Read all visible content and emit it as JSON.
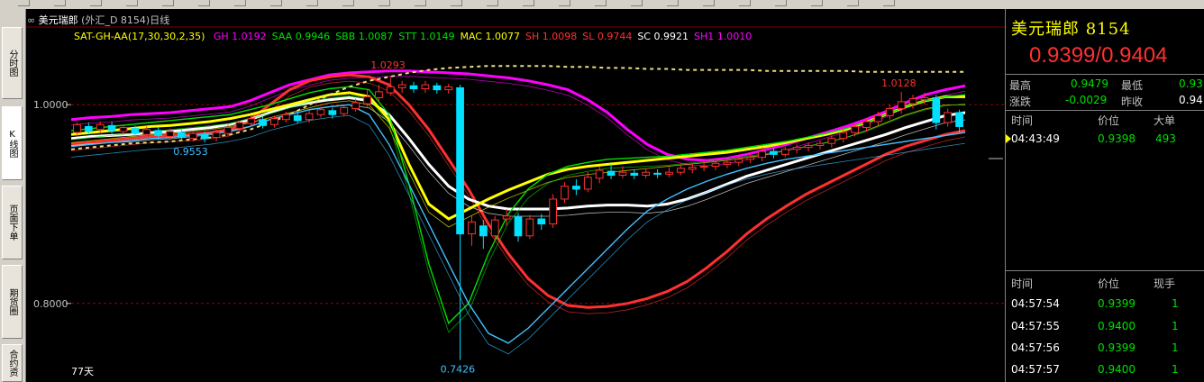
{
  "window": {
    "title_symbol": "美元瑞郎",
    "title_detail": "(外汇_D 8154)日线",
    "link_icon": "link-icon"
  },
  "sidebar": {
    "tabs": [
      {
        "label": "分时图",
        "active": false
      },
      {
        "label": "K线图",
        "active": true
      },
      {
        "label": "页面下单",
        "active": false
      },
      {
        "label": "期货圈",
        "active": false
      },
      {
        "label": "合约资",
        "active": false
      }
    ]
  },
  "indicator": {
    "name": "SAT-GH-AA(17,30,30,2,35)",
    "items": [
      {
        "label": "GH",
        "value": "1.0192",
        "color": "#ff00ff"
      },
      {
        "label": "SAA",
        "value": "0.9946",
        "color": "#00e000"
      },
      {
        "label": "SBB",
        "value": "1.0087",
        "color": "#00e000"
      },
      {
        "label": "STT",
        "value": "1.0149",
        "color": "#00e000"
      },
      {
        "label": "MAC",
        "value": "1.0077",
        "color": "#ffff00"
      },
      {
        "label": "SH",
        "value": "1.0098",
        "color": "#ff3030"
      },
      {
        "label": "SL",
        "value": "0.9744",
        "color": "#ff3030"
      },
      {
        "label": "SC",
        "value": "0.9921",
        "color": "#ffffff"
      },
      {
        "label": "SH1",
        "value": "1.0010",
        "color": "#ff00ff"
      }
    ]
  },
  "chart_data": {
    "type": "candlestick",
    "yaxis_ticks": [
      "1.0000",
      "0.8000"
    ],
    "ylim": [
      0.73,
      1.06
    ],
    "annotations": [
      {
        "text": "1.0293",
        "kind": "high",
        "color": "#ff3030"
      },
      {
        "text": "0.9553",
        "kind": "low",
        "color": "#40c0ff"
      },
      {
        "text": "0.7426",
        "kind": "low",
        "color": "#40c0ff"
      },
      {
        "text": "1.0128",
        "kind": "high",
        "color": "#ff3030"
      }
    ],
    "period_label": "77天",
    "candles": [
      [
        0.972,
        0.98,
        0.968,
        0.982
      ],
      [
        0.978,
        0.973,
        0.97,
        0.982
      ],
      [
        0.975,
        0.98,
        0.972,
        0.983
      ],
      [
        0.979,
        0.974,
        0.971,
        0.983
      ],
      [
        0.973,
        0.977,
        0.97,
        0.98
      ],
      [
        0.976,
        0.971,
        0.968,
        0.979
      ],
      [
        0.97,
        0.975,
        0.967,
        0.978
      ],
      [
        0.974,
        0.969,
        0.966,
        0.977
      ],
      [
        0.968,
        0.973,
        0.964,
        0.976
      ],
      [
        0.972,
        0.967,
        0.964,
        0.975
      ],
      [
        0.966,
        0.971,
        0.963,
        0.974
      ],
      [
        0.97,
        0.966,
        0.962,
        0.973
      ],
      [
        0.967,
        0.972,
        0.963,
        0.975
      ],
      [
        0.971,
        0.977,
        0.968,
        0.98
      ],
      [
        0.976,
        0.982,
        0.973,
        0.984
      ],
      [
        0.981,
        0.986,
        0.978,
        0.989
      ],
      [
        0.985,
        0.979,
        0.976,
        0.988
      ],
      [
        0.98,
        0.986,
        0.977,
        0.989
      ],
      [
        0.985,
        0.99,
        0.982,
        0.993
      ],
      [
        0.989,
        0.984,
        0.981,
        0.992
      ],
      [
        0.985,
        0.991,
        0.982,
        0.994
      ],
      [
        0.99,
        0.995,
        0.987,
        0.998
      ],
      [
        0.994,
        0.99,
        0.986,
        0.997
      ],
      [
        0.991,
        0.997,
        0.988,
        1.0
      ],
      [
        0.996,
        1.002,
        0.993,
        1.006
      ],
      [
        1.001,
        1.008,
        0.998,
        1.015
      ],
      [
        1.007,
        1.013,
        1.004,
        1.02
      ],
      [
        1.012,
        1.018,
        1.009,
        1.029
      ],
      [
        1.017,
        1.02,
        1.012,
        1.024
      ],
      [
        1.019,
        1.016,
        1.012,
        1.023
      ],
      [
        1.016,
        1.02,
        1.012,
        1.024
      ],
      [
        1.019,
        1.015,
        1.011,
        1.022
      ],
      [
        1.015,
        1.018,
        1.011,
        1.021
      ],
      [
        1.017,
        0.87,
        0.743,
        1.02
      ],
      [
        0.87,
        0.882,
        0.858,
        0.888
      ],
      [
        0.878,
        0.868,
        0.855,
        0.884
      ],
      [
        0.868,
        0.884,
        0.863,
        0.888
      ],
      [
        0.885,
        0.888,
        0.878,
        0.895
      ],
      [
        0.887,
        0.868,
        0.862,
        0.891
      ],
      [
        0.868,
        0.885,
        0.865,
        0.889
      ],
      [
        0.885,
        0.88,
        0.874,
        0.89
      ],
      [
        0.88,
        0.905,
        0.876,
        0.91
      ],
      [
        0.905,
        0.918,
        0.901,
        0.922
      ],
      [
        0.918,
        0.915,
        0.909,
        0.925
      ],
      [
        0.915,
        0.927,
        0.912,
        0.932
      ],
      [
        0.926,
        0.934,
        0.921,
        0.938
      ],
      [
        0.933,
        0.929,
        0.925,
        0.94
      ],
      [
        0.929,
        0.932,
        0.926,
        0.938
      ],
      [
        0.931,
        0.929,
        0.925,
        0.935
      ],
      [
        0.929,
        0.932,
        0.926,
        0.936
      ],
      [
        0.931,
        0.93,
        0.926,
        0.935
      ],
      [
        0.93,
        0.932,
        0.927,
        0.937
      ],
      [
        0.932,
        0.936,
        0.929,
        0.94
      ],
      [
        0.935,
        0.937,
        0.931,
        0.941
      ],
      [
        0.937,
        0.938,
        0.933,
        0.942
      ],
      [
        0.938,
        0.941,
        0.934,
        0.944
      ],
      [
        0.94,
        0.942,
        0.936,
        0.946
      ],
      [
        0.942,
        0.945,
        0.938,
        0.948
      ],
      [
        0.945,
        0.947,
        0.941,
        0.951
      ],
      [
        0.947,
        0.953,
        0.943,
        0.957
      ],
      [
        0.953,
        0.95,
        0.946,
        0.956
      ],
      [
        0.95,
        0.955,
        0.947,
        0.958
      ],
      [
        0.955,
        0.957,
        0.951,
        0.96
      ],
      [
        0.957,
        0.959,
        0.953,
        0.962
      ],
      [
        0.959,
        0.961,
        0.955,
        0.964
      ],
      [
        0.961,
        0.966,
        0.957,
        0.969
      ],
      [
        0.966,
        0.972,
        0.962,
        0.975
      ],
      [
        0.972,
        0.978,
        0.968,
        0.981
      ],
      [
        0.977,
        0.983,
        0.973,
        0.986
      ],
      [
        0.983,
        0.989,
        0.979,
        0.993
      ],
      [
        0.989,
        0.996,
        0.985,
        1.0
      ],
      [
        0.996,
        1.003,
        0.991,
        1.013
      ],
      [
        1.001,
        1.006,
        0.996,
        1.01
      ],
      [
        1.005,
        1.007,
        1.0,
        1.012
      ],
      [
        1.007,
        0.982,
        0.975,
        1.01
      ],
      [
        0.982,
        0.992,
        0.978,
        0.996
      ],
      [
        0.992,
        0.978,
        0.972,
        0.995
      ]
    ],
    "series": [
      {
        "color": "#ff00ff",
        "values": [
          0.985,
          0.987,
          0.988,
          0.99,
          0.991,
          0.992,
          0.994,
          0.996,
          0.998,
          1.004,
          1.012,
          1.02,
          1.025,
          1.03,
          1.032,
          1.033,
          1.034,
          1.034,
          1.033,
          1.032,
          1.031,
          1.029,
          1.027,
          1.024,
          1.02,
          1.015,
          1.005,
          0.992,
          0.975,
          0.96,
          0.95,
          0.945,
          0.944,
          0.946,
          0.95,
          0.955,
          0.96,
          0.966,
          0.972,
          0.978,
          0.985,
          0.993,
          1.002,
          1.01,
          1.015,
          1.019
        ]
      },
      {
        "color": "#ff3030",
        "values": [
          0.96,
          0.962,
          0.964,
          0.966,
          0.968,
          0.969,
          0.97,
          0.972,
          0.975,
          0.985,
          1.0,
          1.015,
          1.024,
          1.028,
          1.03,
          1.028,
          1.02,
          1.0,
          0.975,
          0.945,
          0.915,
          0.88,
          0.85,
          0.825,
          0.808,
          0.798,
          0.796,
          0.797,
          0.8,
          0.805,
          0.812,
          0.822,
          0.836,
          0.852,
          0.87,
          0.885,
          0.898,
          0.91,
          0.92,
          0.93,
          0.94,
          0.95,
          0.958,
          0.964,
          0.97,
          0.974
        ]
      },
      {
        "color": "#ffffff",
        "values": [
          0.966,
          0.968,
          0.969,
          0.97,
          0.972,
          0.973,
          0.975,
          0.977,
          0.98,
          0.985,
          0.992,
          0.998,
          1.002,
          1.005,
          1.007,
          1.004,
          0.99,
          0.966,
          0.94,
          0.918,
          0.905,
          0.898,
          0.895,
          0.895,
          0.895,
          0.896,
          0.898,
          0.899,
          0.899,
          0.898,
          0.9,
          0.905,
          0.912,
          0.92,
          0.928,
          0.934,
          0.94,
          0.946,
          0.952,
          0.958,
          0.964,
          0.97,
          0.977,
          0.983,
          0.989,
          0.992
        ]
      },
      {
        "color": "#ffff00",
        "values": [
          0.97,
          0.972,
          0.974,
          0.976,
          0.978,
          0.979,
          0.981,
          0.983,
          0.986,
          0.99,
          0.995,
          1.0,
          1.005,
          1.01,
          1.012,
          1.008,
          0.985,
          0.94,
          0.9,
          0.885,
          0.895,
          0.905,
          0.914,
          0.922,
          0.93,
          0.935,
          0.938,
          0.94,
          0.942,
          0.944,
          0.946,
          0.948,
          0.95,
          0.952,
          0.955,
          0.958,
          0.962,
          0.966,
          0.97,
          0.975,
          0.982,
          0.99,
          0.998,
          1.004,
          1.008,
          1.008
        ]
      },
      {
        "color": "#00e000",
        "values": [
          0.974,
          0.976,
          0.978,
          0.98,
          0.982,
          0.984,
          0.986,
          0.988,
          0.99,
          0.995,
          1.0,
          1.006,
          1.012,
          1.016,
          1.018,
          1.015,
          0.99,
          0.92,
          0.84,
          0.78,
          0.8,
          0.85,
          0.89,
          0.915,
          0.93,
          0.938,
          0.942,
          0.945,
          0.946,
          0.947,
          0.948,
          0.95,
          0.952,
          0.954,
          0.957,
          0.96,
          0.963,
          0.967,
          0.971,
          0.976,
          0.982,
          0.99,
          0.998,
          1.004,
          1.008,
          1.01
        ]
      },
      {
        "color": "#e0e0e0",
        "dashed": true,
        "values": [
          0.955,
          0.957,
          0.959,
          0.961,
          0.962,
          0.963,
          0.965,
          0.967,
          0.97,
          0.975,
          0.982,
          0.99,
          1.0,
          1.01,
          1.018,
          1.024,
          1.028,
          1.032,
          1.035,
          1.037,
          1.038,
          1.039,
          1.039,
          1.039,
          1.039,
          1.038,
          1.038,
          1.037,
          1.037,
          1.036,
          1.036,
          1.035,
          1.035,
          1.035,
          1.035,
          1.034,
          1.034,
          1.034,
          1.034,
          1.034,
          1.033,
          1.033,
          1.033,
          1.033,
          1.033,
          1.033
        ]
      },
      {
        "color": "#40c0ff",
        "values": [
          0.958,
          0.96,
          0.962,
          0.964,
          0.966,
          0.967,
          0.969,
          0.971,
          0.974,
          0.978,
          0.985,
          0.99,
          0.995,
          0.998,
          1.0,
          0.99,
          0.96,
          0.92,
          0.88,
          0.84,
          0.8,
          0.77,
          0.76,
          0.775,
          0.795,
          0.815,
          0.835,
          0.855,
          0.875,
          0.893,
          0.905,
          0.915,
          0.923,
          0.93,
          0.936,
          0.941,
          0.945,
          0.948,
          0.951,
          0.954,
          0.957,
          0.96,
          0.963,
          0.966,
          0.969,
          0.972
        ]
      }
    ]
  },
  "right_panel": {
    "title": "美元瑞郎  8154",
    "quote": "0.9399/0.9404",
    "stats": [
      {
        "label": "最高",
        "value": "0.9479",
        "label2": "最低",
        "value2": "0.93"
      },
      {
        "label": "涨跌",
        "value": "-0.0029",
        "label2": "昨收",
        "value2": "0.94"
      }
    ],
    "big_orders_header": {
      "time": "时间",
      "price": "价位",
      "vol": "大单"
    },
    "big_orders": [
      {
        "time": "04:43:49",
        "price": "0.9398",
        "vol": "493"
      }
    ],
    "ticks_header": {
      "time": "时间",
      "price": "价位",
      "vol": "现手"
    },
    "ticks": [
      {
        "time": "04:57:54",
        "price": "0.9399",
        "vol": "1"
      },
      {
        "time": "04:57:55",
        "price": "0.9400",
        "vol": "1"
      },
      {
        "time": "04:57:56",
        "price": "0.9399",
        "vol": "1"
      },
      {
        "time": "04:57:57",
        "price": "0.9400",
        "vol": "1"
      }
    ],
    "colors": {
      "up": "#ff3030",
      "down": "#00e000",
      "accent": "#ffff00",
      "bull_candle": "#ff3030",
      "bear_candle": "#00e0ff"
    }
  }
}
